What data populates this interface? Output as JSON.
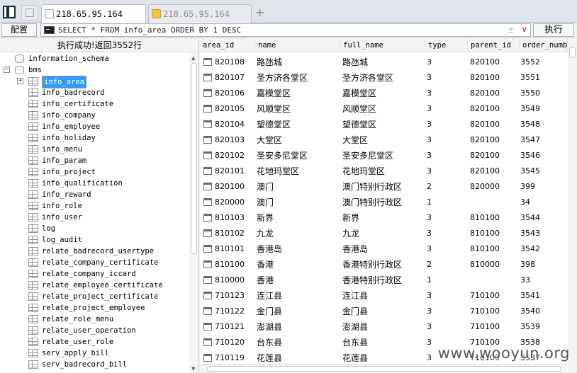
{
  "tabs": [
    {
      "label": "218.65.95.164",
      "active": true
    },
    {
      "label": "218.65.95.164",
      "active": false
    }
  ],
  "new_tab_symbol": "+",
  "toolbar": {
    "config_label": "配置",
    "sql_query": "SELECT * FROM info_area ORDER BY 1 DESC",
    "sql_pm_symbol": "±",
    "sql_dropdown_symbol": "∨",
    "execute_label": "执行"
  },
  "left_panel": {
    "status_text": "执行成功!返回3552行",
    "tree": [
      {
        "label": "information_schema",
        "type": "database",
        "expander": ""
      },
      {
        "label": "bms",
        "type": "database",
        "expander": "−"
      },
      {
        "label": "info_area",
        "type": "table",
        "expander": "+",
        "selected": true
      },
      {
        "label": "info_badrecord",
        "type": "table"
      },
      {
        "label": "info_certificate",
        "type": "table"
      },
      {
        "label": "info_company",
        "type": "table"
      },
      {
        "label": "info_employee",
        "type": "table"
      },
      {
        "label": "info_holiday",
        "type": "table"
      },
      {
        "label": "info_menu",
        "type": "table"
      },
      {
        "label": "info_param",
        "type": "table"
      },
      {
        "label": "info_project",
        "type": "table"
      },
      {
        "label": "info_qualification",
        "type": "table"
      },
      {
        "label": "info_reward",
        "type": "table"
      },
      {
        "label": "info_role",
        "type": "table"
      },
      {
        "label": "info_user",
        "type": "table"
      },
      {
        "label": "log",
        "type": "table"
      },
      {
        "label": "log_audit",
        "type": "table"
      },
      {
        "label": "relate_badrecord_usertype",
        "type": "table"
      },
      {
        "label": "relate_company_certificate",
        "type": "table"
      },
      {
        "label": "relate_company_iccard",
        "type": "table"
      },
      {
        "label": "relate_employee_certificate",
        "type": "table"
      },
      {
        "label": "relate_project_certificate",
        "type": "table"
      },
      {
        "label": "relate_project_employee",
        "type": "table"
      },
      {
        "label": "relate_role_menu",
        "type": "table"
      },
      {
        "label": "relate_user_operation",
        "type": "table"
      },
      {
        "label": "relate_user_role",
        "type": "table"
      },
      {
        "label": "serv_apply_bill",
        "type": "table"
      },
      {
        "label": "serv_badrecord_bill",
        "type": "table"
      }
    ]
  },
  "grid": {
    "columns": [
      "area_id",
      "name",
      "full_name",
      "type",
      "parent_id",
      "order_numb"
    ],
    "rows": [
      [
        "820108",
        "路氹城",
        "路氹城",
        "3",
        "820100",
        "3552"
      ],
      [
        "820107",
        "圣方济各堂区",
        "圣方济各堂区",
        "3",
        "820100",
        "3551"
      ],
      [
        "820106",
        "嘉模堂区",
        "嘉模堂区",
        "3",
        "820100",
        "3550"
      ],
      [
        "820105",
        "风顺堂区",
        "风顺堂区",
        "3",
        "820100",
        "3549"
      ],
      [
        "820104",
        "望德堂区",
        "望德堂区",
        "3",
        "820100",
        "3548"
      ],
      [
        "820103",
        "大堂区",
        "大堂区",
        "3",
        "820100",
        "3547"
      ],
      [
        "820102",
        "圣安多尼堂区",
        "圣安多尼堂区",
        "3",
        "820100",
        "3546"
      ],
      [
        "820101",
        "花地玛堂区",
        "花地玛堂区",
        "3",
        "820100",
        "3545"
      ],
      [
        "820100",
        "澳门",
        "澳门特别行政区",
        "2",
        "820000",
        "399"
      ],
      [
        "820000",
        "澳门",
        "澳门特别行政区",
        "1",
        "",
        "34"
      ],
      [
        "810103",
        "新界",
        "新界",
        "3",
        "810100",
        "3544"
      ],
      [
        "810102",
        "九龙",
        "九龙",
        "3",
        "810100",
        "3543"
      ],
      [
        "810101",
        "香港岛",
        "香港岛",
        "3",
        "810100",
        "3542"
      ],
      [
        "810100",
        "香港",
        "香港特别行政区",
        "2",
        "810000",
        "398"
      ],
      [
        "810000",
        "香港",
        "香港特别行政区",
        "1",
        "",
        "33"
      ],
      [
        "710123",
        "连江县",
        "连江县",
        "3",
        "710100",
        "3541"
      ],
      [
        "710122",
        "金门县",
        "金门县",
        "3",
        "710100",
        "3540"
      ],
      [
        "710121",
        "澎湖县",
        "澎湖县",
        "3",
        "710100",
        "3539"
      ],
      [
        "710120",
        "台东县",
        "台东县",
        "3",
        "710100",
        "3538"
      ],
      [
        "710119",
        "花莲县",
        "花莲县",
        "3",
        "710100",
        "3537"
      ]
    ]
  },
  "watermark": "www.wooyun.org"
}
